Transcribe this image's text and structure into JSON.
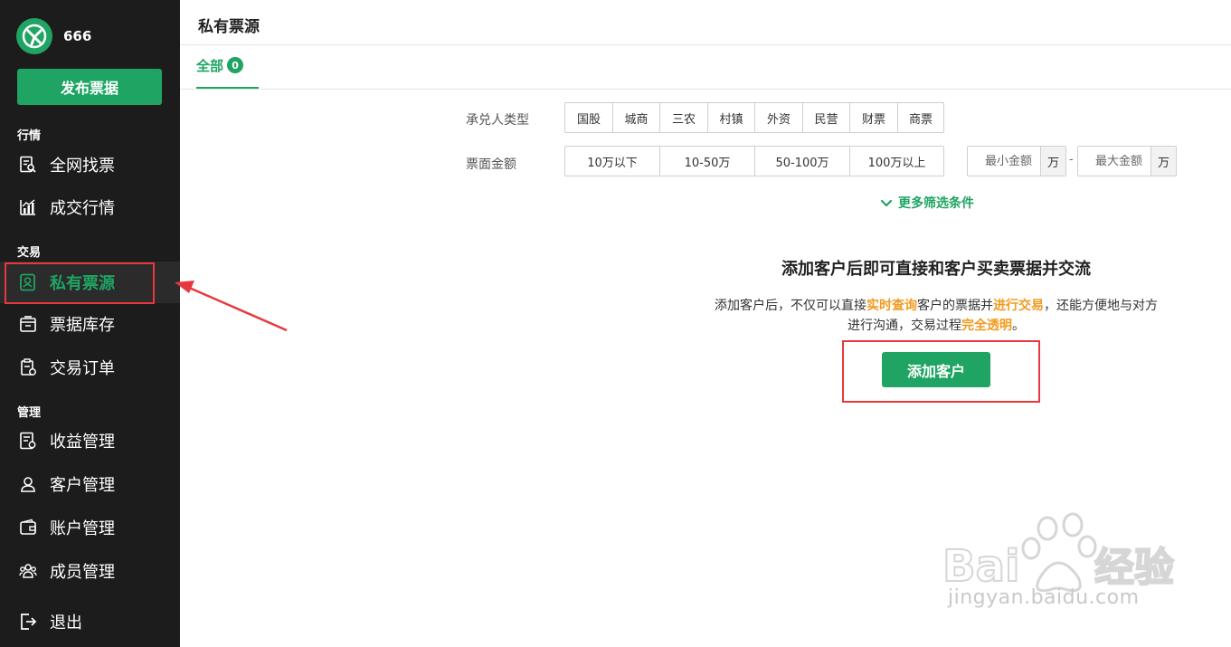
{
  "sidebar": {
    "brand_name": "666",
    "publish_button": "发布票据",
    "sections": [
      {
        "title": "行情",
        "items": [
          "全网找票",
          "成交行情"
        ]
      },
      {
        "title": "交易",
        "items": [
          "私有票源",
          "票据库存",
          "交易订单"
        ]
      },
      {
        "title": "管理",
        "items": [
          "收益管理",
          "客户管理",
          "账户管理",
          "成员管理"
        ]
      }
    ],
    "logout": "退出",
    "active_item": "私有票源"
  },
  "header": {
    "title": "私有票源",
    "tabs": [
      {
        "label": "全部",
        "count": "0"
      }
    ]
  },
  "filters": {
    "acceptor_label": "承兑人类型",
    "acceptor_options": [
      "国股",
      "城商",
      "三农",
      "村镇",
      "外资",
      "民营",
      "财票",
      "商票"
    ],
    "amount_label": "票面金额",
    "amount_options": [
      "10万以下",
      "10-50万",
      "50-100万",
      "100万以上"
    ],
    "min_placeholder": "最小金额",
    "max_placeholder": "最大金额",
    "unit": "万",
    "dash": "-",
    "more": "更多筛选条件"
  },
  "empty_state": {
    "title": "添加客户后即可直接和客户买卖票据并交流",
    "desc_1": "添加客户后，不仅可以直接",
    "desc_hl_1": "实时查询",
    "desc_2": "客户的票据并",
    "desc_hl_2": "进行交易",
    "desc_3": "，还能方便地与对方进行沟通，交易过程",
    "desc_hl_3": "完全透明",
    "desc_4": "。",
    "button": "添加客户"
  },
  "watermark": {
    "text": "jingyan.baidu.com"
  },
  "colors": {
    "accent": "#1fa463",
    "sidebar_bg": "#1c1c1c",
    "highlight_text": "#f29a1e",
    "annotation_red": "#e8383d"
  }
}
